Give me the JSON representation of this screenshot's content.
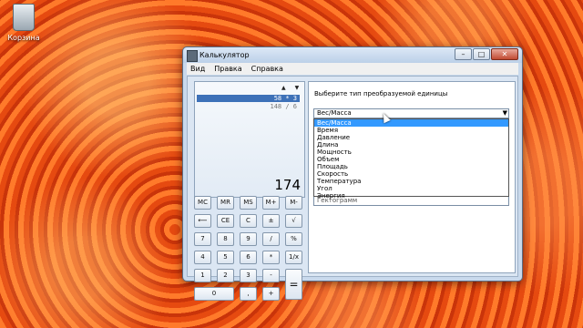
{
  "desktop": {
    "recycle_bin_label": "Корзина"
  },
  "window": {
    "title": "Калькулятор",
    "buttons": {
      "minimize": "–",
      "maximize": "□",
      "close": "✕"
    }
  },
  "menu": [
    "Вид",
    "Правка",
    "Справка"
  ],
  "display": {
    "history": [
      "58 * 3",
      "148 / 6"
    ],
    "result": "174",
    "arrow_up": "▲",
    "arrow_down": "▼"
  },
  "keys": {
    "mc": "MC",
    "mr": "MR",
    "ms": "MS",
    "mplus": "M+",
    "mminus": "M-",
    "back": "⟵",
    "ce": "CE",
    "c": "C",
    "plusminus": "±",
    "sqrt": "√",
    "k7": "7",
    "k8": "8",
    "k9": "9",
    "div": "/",
    "pct": "%",
    "k4": "4",
    "k5": "5",
    "k6": "6",
    "mul": "*",
    "inv": "1/x",
    "k1": "1",
    "k2": "2",
    "k3": "3",
    "sub": "-",
    "eq": "=",
    "k0": "0",
    "dot": ",",
    "add": "+"
  },
  "converter": {
    "prompt": "Выберите тип преобразуемой единицы",
    "selected": "Вес/Масса",
    "options": [
      "Вес/Масса",
      "Время",
      "Давление",
      "Длина",
      "Мощность",
      "Объем",
      "Площадь",
      "Скорость",
      "Температура",
      "Угол",
      "Энергия"
    ],
    "second_value": "Гектограмм"
  }
}
